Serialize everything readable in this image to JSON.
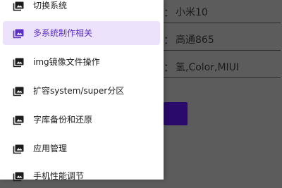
{
  "background_form": {
    "separator": "：",
    "fields": [
      {
        "value": "小米10"
      },
      {
        "value": "高通865"
      },
      {
        "value": "氢,Color,MIUI"
      }
    ]
  },
  "drawer": {
    "selected_index": 1,
    "items": [
      {
        "label": "切换系统",
        "icon": "image-icon"
      },
      {
        "label": "多系统制作相关",
        "icon": "image-icon"
      },
      {
        "label": "img镜像文件操作",
        "icon": "image-icon"
      },
      {
        "label": "扩容system/super分区",
        "icon": "image-icon"
      },
      {
        "label": "字库备份和还原",
        "icon": "image-icon"
      },
      {
        "label": "应用管理",
        "icon": "image-icon"
      },
      {
        "label": "手机性能调节",
        "icon": "image-icon"
      }
    ]
  },
  "colors": {
    "active_text": "#5b2fc4",
    "active_bg": "#ece2fb",
    "scrim": "#5c5c5c",
    "primary_button": "#2a0a6a"
  }
}
